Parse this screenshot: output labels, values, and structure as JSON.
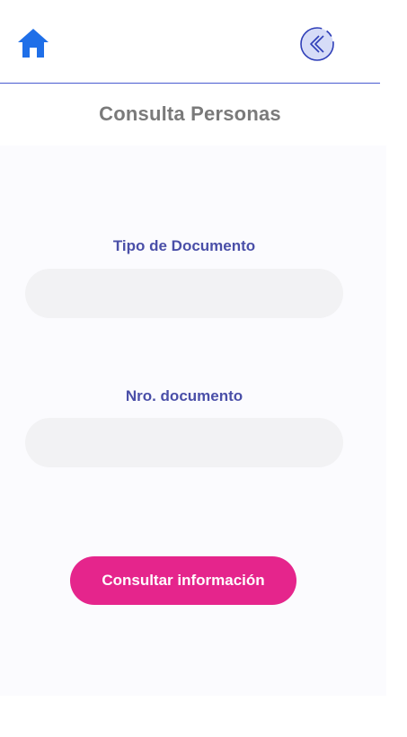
{
  "header": {
    "home_icon": "home-icon",
    "back_icon": "back-chevron-circle-icon",
    "accent_color": "#1f6fe8",
    "divider_color": "#4a5bd0"
  },
  "page": {
    "title": "Consulta Personas"
  },
  "form": {
    "doc_type": {
      "label": "Tipo de Documento",
      "value": "",
      "placeholder": ""
    },
    "doc_number": {
      "label": "Nro. documento",
      "value": "",
      "placeholder": ""
    },
    "submit_label": "Consultar información",
    "submit_color": "#e5258c",
    "label_color": "#4a4fa8"
  }
}
